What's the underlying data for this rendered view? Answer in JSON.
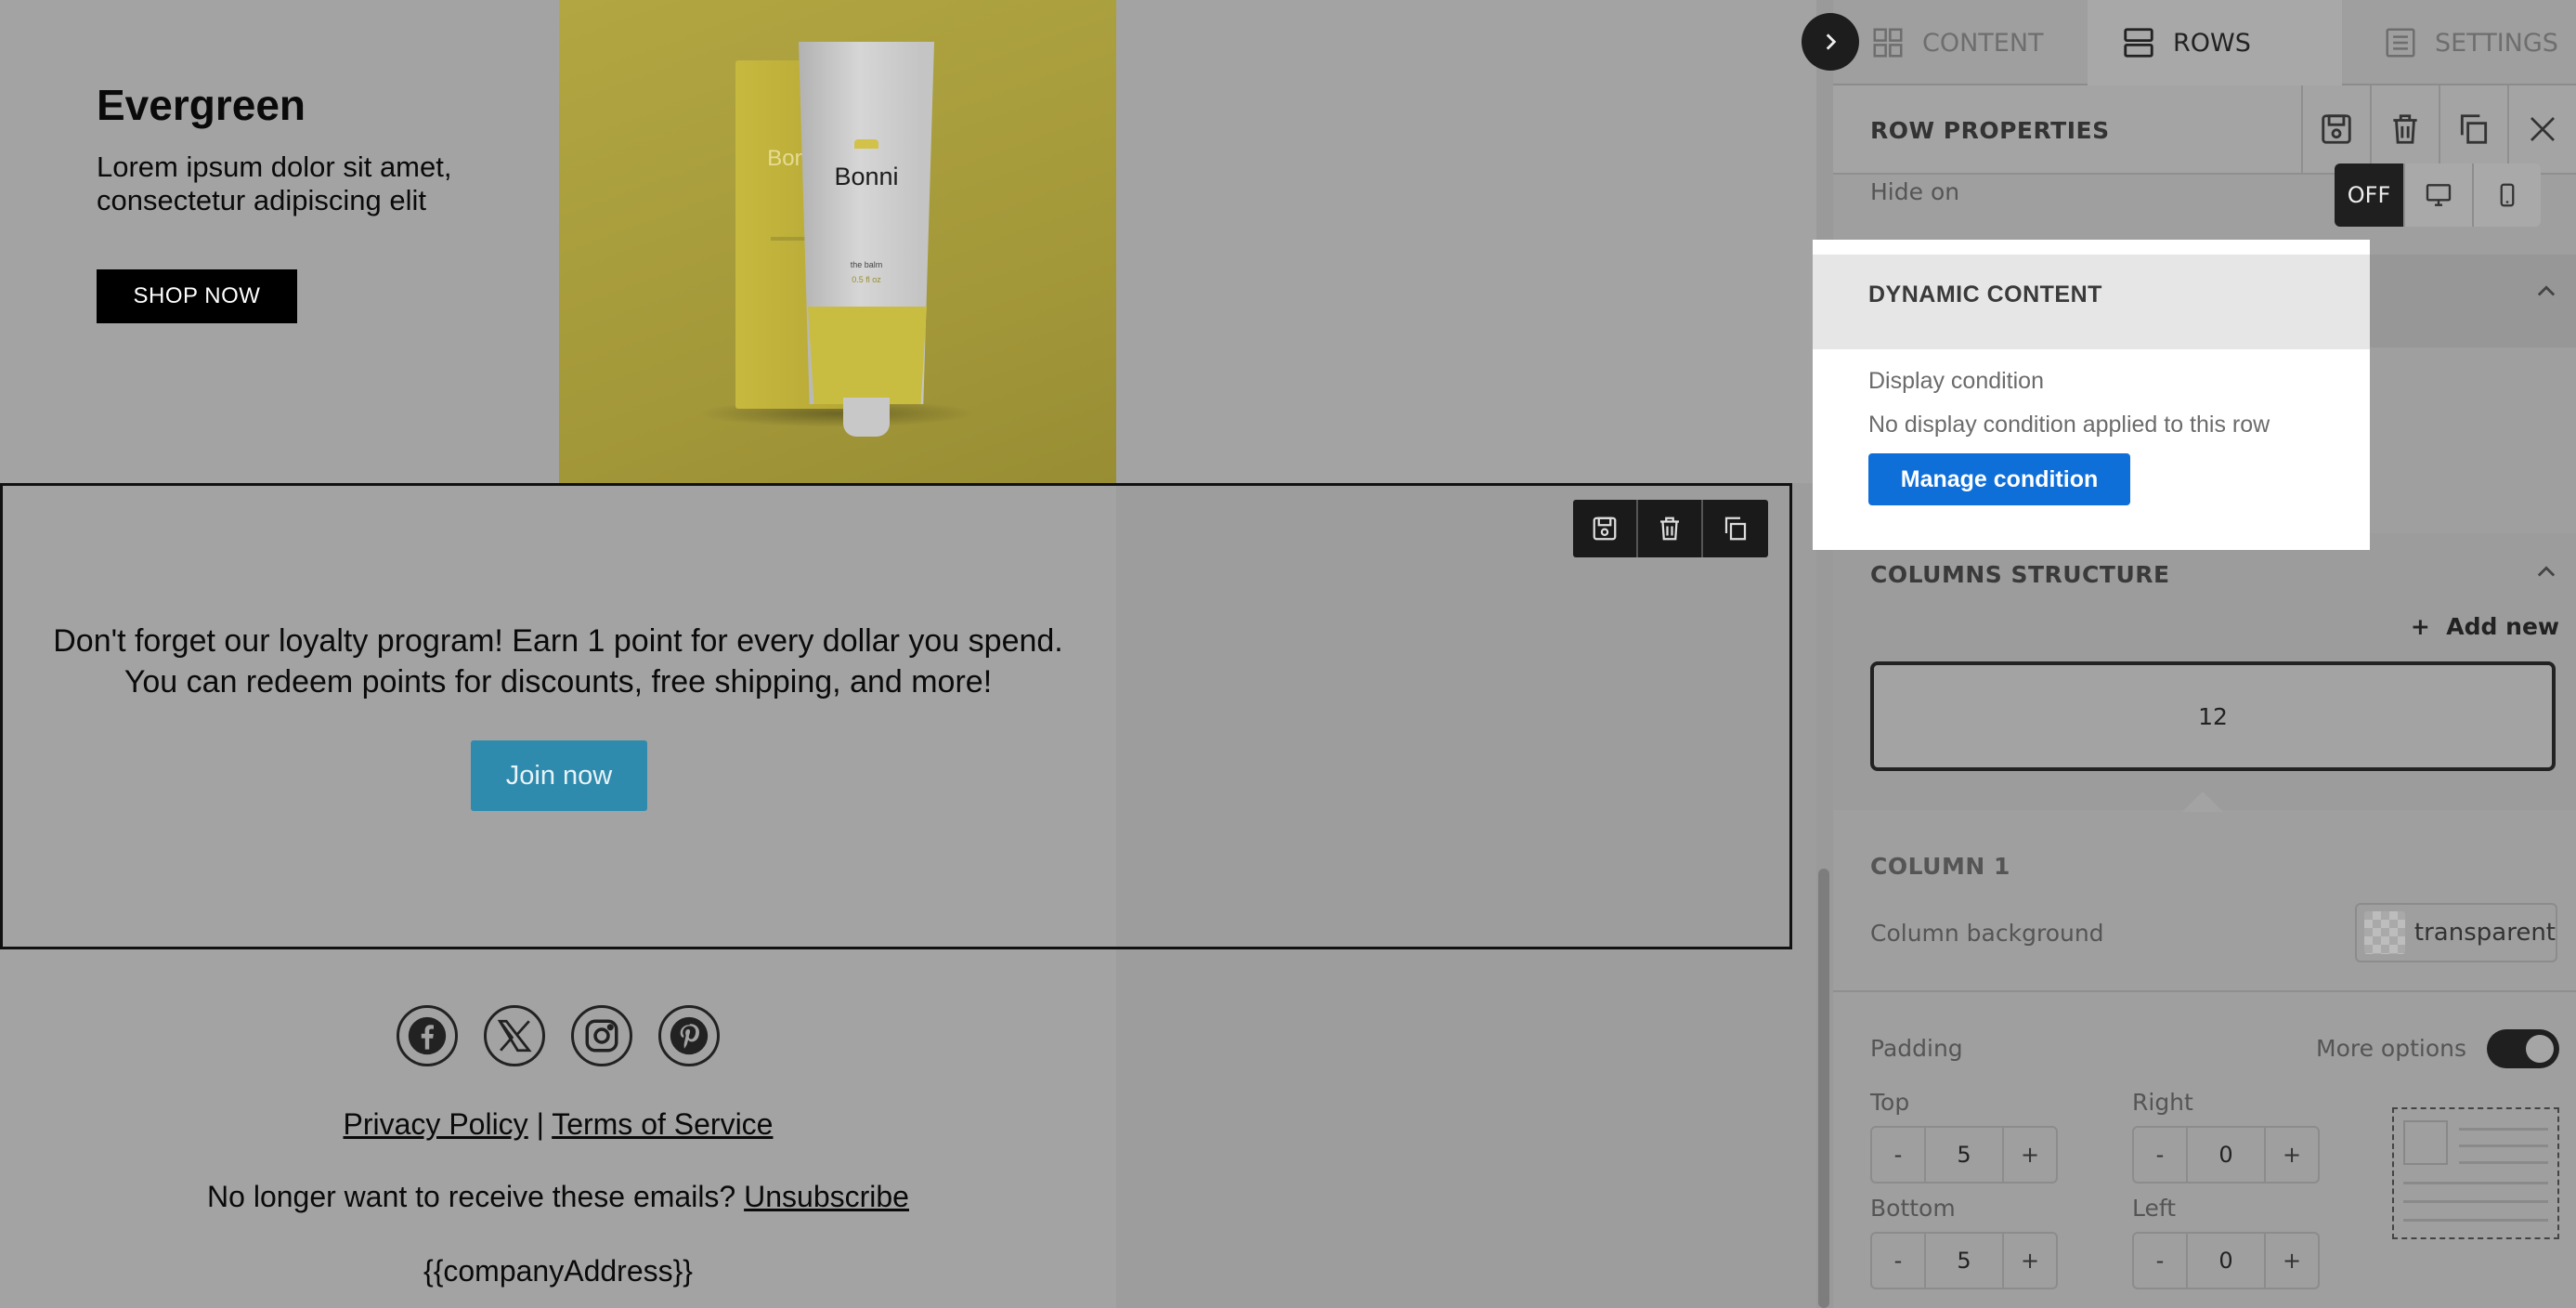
{
  "canvas": {
    "hero": {
      "title": "Evergreen",
      "subtitle": "Lorem ipsum dolor sit amet, consectetur adipiscing elit",
      "button": "SHOP NOW",
      "product_brand": "Bonni",
      "product_box_brand": "Bonni",
      "product_small_1": "the balm",
      "product_small_2": "0.5 fl oz"
    },
    "loyalty": {
      "line1": "Don't forget our loyalty program! Earn 1 point for every dollar you spend.",
      "line2": "You can redeem points for discounts, free shipping, and more!",
      "button": "Join now"
    },
    "footer": {
      "social": [
        "facebook-icon",
        "x-icon",
        "instagram-icon",
        "pinterest-icon"
      ],
      "privacy": "Privacy Policy",
      "separator": "|",
      "terms": "Terms of Service",
      "unsubscribe_text": "No longer want to receive these emails?",
      "unsubscribe_link": "Unsubscribe",
      "address": "{{companyAddress}}"
    }
  },
  "panel": {
    "tabs": [
      {
        "label": "CONTENT",
        "icon": "grid-icon",
        "active": false
      },
      {
        "label": "ROWS",
        "icon": "rows-icon",
        "active": true
      },
      {
        "label": "SETTINGS",
        "icon": "settings-list-icon",
        "active": false
      }
    ],
    "row_properties": {
      "title": "ROW PROPERTIES",
      "hide_on_label": "Hide on",
      "hide_on_value": "OFF"
    },
    "dynamic_content": {
      "title": "DYNAMIC CONTENT",
      "display_condition_label": "Display condition",
      "no_condition": "No display condition applied to this row",
      "manage_button": "Manage condition"
    },
    "columns_structure": {
      "title": "COLUMNS STRUCTURE",
      "add_new": "Add new",
      "add_new_plus": "+",
      "columns": [
        "12"
      ]
    },
    "column1": {
      "title": "COLUMN 1",
      "background_label": "Column background",
      "background_value": "transparent",
      "padding_label": "Padding",
      "more_options": "More options",
      "top_label": "Top",
      "top_value": "5",
      "right_label": "Right",
      "right_value": "0",
      "bottom_label": "Bottom",
      "bottom_value": "5",
      "left_label": "Left",
      "left_value": "0",
      "minus": "-",
      "plus": "+"
    },
    "colors": {
      "accent": "#0f6fd9",
      "dark": "#1f1f1f"
    }
  }
}
